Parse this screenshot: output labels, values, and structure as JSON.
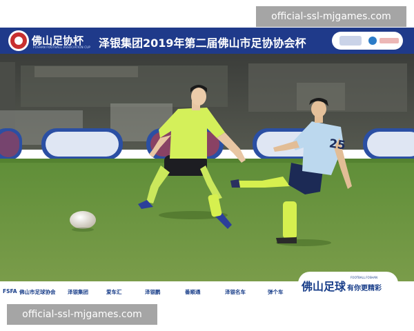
{
  "watermark": {
    "text": "official-ssl-mjgames.com"
  },
  "banner": {
    "logo_text": "佛山足协杯",
    "logo_subtext": "FOSHAN FOOTBALL ASSOCIATION CUP",
    "title": "泽银集团2019年第二届佛山市足协协会杯",
    "sponsor_logos": [
      "FSFA",
      "泽银集团"
    ]
  },
  "sponsors_bar": {
    "items": [
      "FSFA",
      "佛山市足球协会",
      "泽银集团",
      "爱车汇",
      "泽银鹏",
      "番顺通",
      "泽银名车",
      "弹个车"
    ],
    "brand": "佛山足球",
    "brand_tagline": "有你更精彩",
    "brand_small": "FOOTBALL.FOSHAN"
  },
  "scene": {
    "board_label": "FSFA",
    "jersey_number": "25"
  },
  "colors": {
    "banner_blue": "#1f3a8a",
    "pitch_green": "#5c8a34",
    "jersey_lime": "#d4f05a",
    "jersey_lightblue": "#bcd8ee",
    "shorts_navy": "#1c2a55",
    "watermark_gray": "#828282"
  }
}
